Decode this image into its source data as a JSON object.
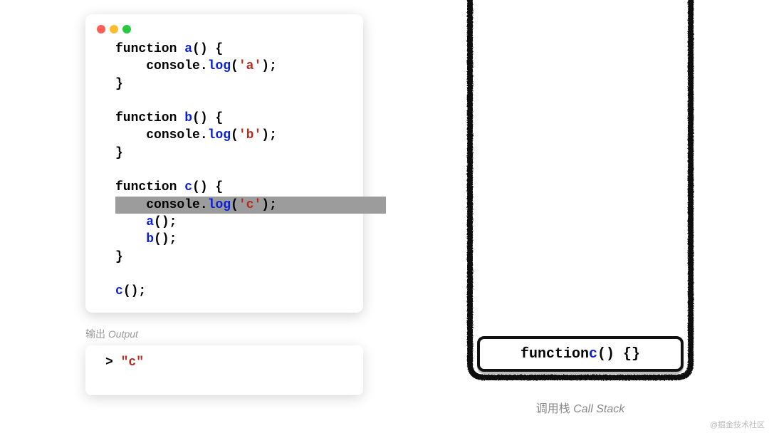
{
  "code": {
    "lines": [
      {
        "indent": 0,
        "segs": [
          {
            "t": "function ",
            "c": "kw"
          },
          {
            "t": "a",
            "c": "fn"
          },
          {
            "t": "() {",
            "c": "punct"
          }
        ]
      },
      {
        "indent": 1,
        "segs": [
          {
            "t": "console.",
            "c": "kw"
          },
          {
            "t": "log",
            "c": "fn"
          },
          {
            "t": "(",
            "c": "punct"
          },
          {
            "t": "'a'",
            "c": "str"
          },
          {
            "t": ");",
            "c": "punct"
          }
        ]
      },
      {
        "indent": 0,
        "segs": [
          {
            "t": "}",
            "c": "punct"
          }
        ]
      },
      {
        "indent": 0,
        "blank": true
      },
      {
        "indent": 0,
        "segs": [
          {
            "t": "function ",
            "c": "kw"
          },
          {
            "t": "b",
            "c": "fn"
          },
          {
            "t": "() {",
            "c": "punct"
          }
        ]
      },
      {
        "indent": 1,
        "segs": [
          {
            "t": "console.",
            "c": "kw"
          },
          {
            "t": "log",
            "c": "fn"
          },
          {
            "t": "(",
            "c": "punct"
          },
          {
            "t": "'b'",
            "c": "str"
          },
          {
            "t": ");",
            "c": "punct"
          }
        ]
      },
      {
        "indent": 0,
        "segs": [
          {
            "t": "}",
            "c": "punct"
          }
        ]
      },
      {
        "indent": 0,
        "blank": true
      },
      {
        "indent": 0,
        "segs": [
          {
            "t": "function ",
            "c": "kw"
          },
          {
            "t": "c",
            "c": "fn"
          },
          {
            "t": "() {",
            "c": "punct"
          }
        ]
      },
      {
        "indent": 1,
        "hl": true,
        "segs": [
          {
            "t": "console.",
            "c": "kw"
          },
          {
            "t": "log",
            "c": "fn"
          },
          {
            "t": "(",
            "c": "punct"
          },
          {
            "t": "'c'",
            "c": "str"
          },
          {
            "t": ");",
            "c": "punct"
          }
        ]
      },
      {
        "indent": 1,
        "segs": [
          {
            "t": "a",
            "c": "fn"
          },
          {
            "t": "();",
            "c": "punct"
          }
        ]
      },
      {
        "indent": 1,
        "segs": [
          {
            "t": "b",
            "c": "fn"
          },
          {
            "t": "();",
            "c": "punct"
          }
        ]
      },
      {
        "indent": 0,
        "segs": [
          {
            "t": "}",
            "c": "punct"
          }
        ]
      },
      {
        "indent": 0,
        "blank": true
      },
      {
        "indent": 0,
        "segs": [
          {
            "t": "c",
            "c": "fn"
          },
          {
            "t": "();",
            "c": "punct"
          }
        ]
      }
    ]
  },
  "output": {
    "label_cn": "输出 ",
    "label_en": "Output",
    "prompt": "> ",
    "value": "\"c\""
  },
  "callstack": {
    "label_cn": "调用栈 ",
    "label_en": "Call Stack",
    "frames": [
      {
        "segs": [
          {
            "t": "function ",
            "c": "kw"
          },
          {
            "t": "c",
            "c": "fn"
          },
          {
            "t": "() {}",
            "c": "punct"
          }
        ]
      }
    ]
  },
  "watermark": "@掘金技术社区"
}
